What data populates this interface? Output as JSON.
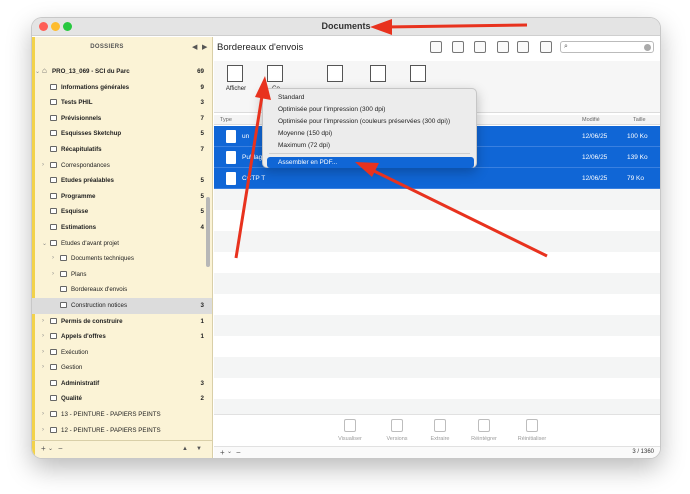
{
  "window": {
    "title": "Documents"
  },
  "sidebar": {
    "header": "DOSSIERS",
    "prev_arrow": "◀",
    "next_arrow": "▶",
    "root": {
      "label": "PRO_13_069 - SCI du Parc",
      "count": "69"
    },
    "items": [
      {
        "label": "Informations générales",
        "count": "9",
        "bold": true,
        "chevron": false
      },
      {
        "label": "Tests PHIL",
        "count": "3",
        "bold": true,
        "chevron": false
      },
      {
        "label": "Prévisionnels",
        "count": "7",
        "bold": true,
        "chevron": false
      },
      {
        "label": "Esquisses Sketchup",
        "count": "5",
        "bold": true,
        "chevron": false
      },
      {
        "label": "Récapitulatifs",
        "count": "7",
        "bold": true,
        "chevron": false
      },
      {
        "label": "Correspondances",
        "count": "",
        "bold": false,
        "chevron": true
      },
      {
        "label": "Etudes préalables",
        "count": "5",
        "bold": true,
        "chevron": false
      },
      {
        "label": "Programme",
        "count": "5",
        "bold": true,
        "chevron": false
      },
      {
        "label": "Esquisse",
        "count": "5",
        "bold": true,
        "chevron": false
      },
      {
        "label": "Estimations",
        "count": "4",
        "bold": true,
        "chevron": false
      },
      {
        "label": "Etudes d'avant projet",
        "count": "",
        "bold": false,
        "chevron": true,
        "expanded": true
      },
      {
        "label": "Documents techniques",
        "count": "",
        "bold": false,
        "chevron": true,
        "level": 2
      },
      {
        "label": "Plans",
        "count": "",
        "bold": false,
        "chevron": true,
        "level": 2
      },
      {
        "label": "Bordereaux d'envois",
        "count": "",
        "bold": false,
        "chevron": false,
        "level": 2
      },
      {
        "label": "Construction notices",
        "count": "3",
        "bold": false,
        "chevron": false,
        "level": 2,
        "selected": true
      },
      {
        "label": "Permis de construire",
        "count": "1",
        "bold": true,
        "chevron": true
      },
      {
        "label": "Appels d'offres",
        "count": "1",
        "bold": true,
        "chevron": true
      },
      {
        "label": "Exécution",
        "count": "",
        "bold": false,
        "chevron": true
      },
      {
        "label": "Gestion",
        "count": "",
        "bold": false,
        "chevron": true
      },
      {
        "label": "Administratif",
        "count": "3",
        "bold": true,
        "chevron": false
      },
      {
        "label": "Qualité",
        "count": "2",
        "bold": true,
        "chevron": false
      },
      {
        "label": "13 - PEINTURE - PAPIERS PEINTS",
        "count": "",
        "bold": false,
        "chevron": true
      },
      {
        "label": "12 - PEINTURE - PAPIERS PEINTS",
        "count": "",
        "bold": false,
        "chevron": true
      }
    ],
    "footer": {
      "add": "+",
      "add_menu": "⌄",
      "remove": "−",
      "up": "▲",
      "down": "▼"
    }
  },
  "main": {
    "title": "Bordereaux d'envois",
    "search": {
      "placeholder": ""
    },
    "toolbar": [
      {
        "label": "Afficher",
        "icon": "display-icon"
      },
      {
        "label": "Co",
        "icon": "convert-icon"
      },
      {
        "label": "",
        "icon": "scan-icon"
      },
      {
        "label": "",
        "icon": "document-icon"
      },
      {
        "label": "",
        "icon": "text-doc-icon"
      }
    ],
    "columns": {
      "type": "Type",
      "modified": "Modifié",
      "size": "Taille"
    },
    "files": [
      {
        "name": "un",
        "date": "12/06/25",
        "size": "100 Ko"
      },
      {
        "name": "Publag",
        "date": "12/06/25",
        "size": "139 Ko"
      },
      {
        "name": "CCTP T",
        "date": "12/06/25",
        "size": "79 Ko"
      }
    ],
    "bottom_actions": [
      {
        "label": "Visualiser",
        "icon": "view-icon"
      },
      {
        "label": "Versions",
        "icon": "versions-icon"
      },
      {
        "label": "Extraire",
        "icon": "extract-icon"
      },
      {
        "label": "Réintégrer",
        "icon": "reintegrate-icon"
      },
      {
        "label": "Réinitialiser",
        "icon": "reset-icon"
      }
    ],
    "footer": {
      "add": "+",
      "add_menu": "⌄",
      "remove": "−",
      "count": "3 / 1360"
    }
  },
  "menu": {
    "items": [
      "Standard",
      "Optimisée pour l'impression (300 dpi)",
      "Optimisée pour l'impression (couleurs préservées (300 dpi))",
      "Moyenne (150 dpi)",
      "Maximum (72 dpi)",
      "Assembler en PDF..."
    ],
    "selected_index": 5
  },
  "colors": {
    "accent": "#1066d6",
    "sidebar_bg": "#fbf3d6",
    "annotation": "#e8321e"
  }
}
